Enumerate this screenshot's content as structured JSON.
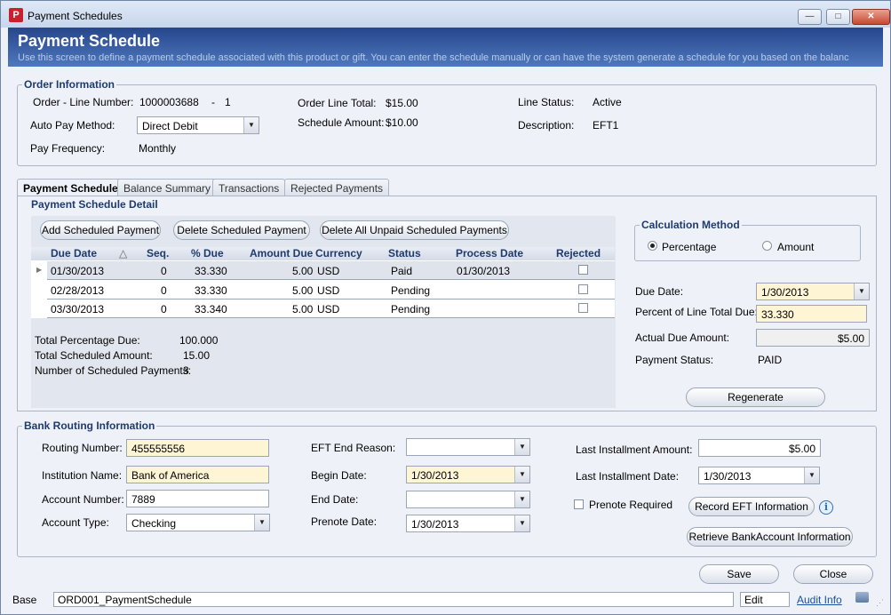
{
  "window": {
    "title": "Payment Schedules"
  },
  "header": {
    "title": "Payment Schedule",
    "subtitle": "Use this screen to define a payment schedule associated with this product or gift. You can enter the schedule manually or can have the system generate a schedule for you based on the balanc"
  },
  "order_info": {
    "group_title": "Order Information",
    "order_line_label": "Order - Line Number:",
    "order_number": "1000003688",
    "dash": "-",
    "line_number": "1",
    "auto_pay_label": "Auto Pay Method:",
    "auto_pay_value": "Direct Debit",
    "pay_freq_label": "Pay Frequency:",
    "pay_freq_value": "Monthly",
    "line_total_label": "Order Line Total:",
    "line_total_value": "$15.00",
    "schedule_amount_label": "Schedule Amount:",
    "schedule_amount_value": "$10.00",
    "line_status_label": "Line Status:",
    "line_status_value": "Active",
    "description_label": "Description:",
    "description_value": "EFT1"
  },
  "tabs": [
    {
      "label": "Payment Schedule"
    },
    {
      "label": "Balance Summary"
    },
    {
      "label": "Transactions"
    },
    {
      "label": "Rejected Payments"
    }
  ],
  "detail": {
    "group_title": "Payment Schedule Detail",
    "add_button": "Add Scheduled Payment",
    "delete_button": "Delete Scheduled Payment",
    "delete_all_button": "Delete All Unpaid Scheduled Payments",
    "columns": [
      "Due Date",
      "Seq.",
      "% Due",
      "Amount Due",
      "Currency",
      "Status",
      "Process Date",
      "Rejected"
    ],
    "rows": [
      {
        "due_date": "01/30/2013",
        "seq": "0",
        "pct": "33.330",
        "amount": "5.00",
        "currency": "USD",
        "status": "Paid",
        "process_date": "01/30/2013",
        "rejected": false
      },
      {
        "due_date": "02/28/2013",
        "seq": "0",
        "pct": "33.330",
        "amount": "5.00",
        "currency": "USD",
        "status": "Pending",
        "process_date": "",
        "rejected": false
      },
      {
        "due_date": "03/30/2013",
        "seq": "0",
        "pct": "33.340",
        "amount": "5.00",
        "currency": "USD",
        "status": "Pending",
        "process_date": "",
        "rejected": false
      }
    ],
    "totals": {
      "pct_label": "Total Percentage Due:",
      "pct_value": "100.000",
      "amount_label": "Total Scheduled Amount:",
      "amount_value": "15.00",
      "count_label": "Number of Scheduled Payments:",
      "count_value": "3"
    }
  },
  "calc": {
    "group_title": "Calculation Method",
    "percentage_label": "Percentage",
    "amount_label": "Amount",
    "selected": "Percentage",
    "due_date_label": "Due Date:",
    "due_date_value": "1/30/2013",
    "percent_label": "Percent of Line Total Due:",
    "percent_value": "33.330",
    "actual_label": "Actual Due Amount:",
    "actual_value": "$5.00",
    "payment_status_label": "Payment Status:",
    "payment_status_value": "PAID",
    "regenerate_button": "Regenerate"
  },
  "bank": {
    "group_title": "Bank Routing Information",
    "routing_label": "Routing Number:",
    "routing_value": "455555556",
    "institution_label": "Institution Name:",
    "institution_value": "Bank of America",
    "account_label": "Account Number:",
    "account_value": "7889",
    "account_type_label": "Account Type:",
    "account_type_value": "Checking",
    "eft_end_label": "EFT End Reason:",
    "eft_end_value": "",
    "begin_date_label": "Begin Date:",
    "begin_date_value": "1/30/2013",
    "end_date_label": "End Date:",
    "end_date_value": "",
    "prenote_date_label": "Prenote Date:",
    "prenote_date_value": "1/30/2013",
    "last_amount_label": "Last Installment Amount:",
    "last_amount_value": "$5.00",
    "last_date_label": "Last Installment Date:",
    "last_date_value": "1/30/2013",
    "prenote_required_label": "Prenote Required",
    "record_eft_button": "Record EFT Information",
    "retrieve_button": "Retrieve BankAccount Information"
  },
  "footer": {
    "save_button": "Save",
    "close_button": "Close"
  },
  "status": {
    "base": "Base",
    "form_id": "ORD001_PaymentSchedule",
    "mode": "Edit",
    "audit": "Audit Info"
  }
}
